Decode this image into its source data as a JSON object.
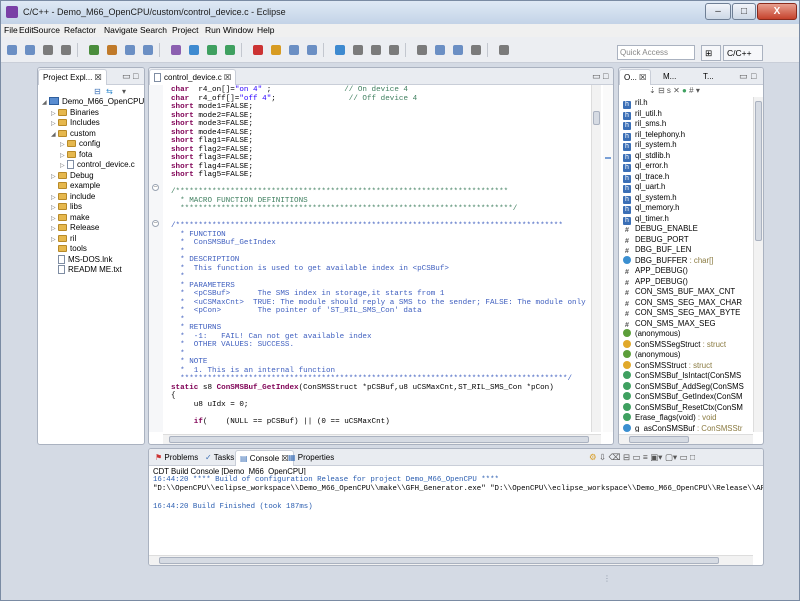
{
  "window": {
    "title": "C/C++ - Demo_M66_OpenCPU/custom/control_device.c - Eclipse",
    "min": "–",
    "max": "□",
    "close": "X"
  },
  "menu": [
    "File",
    "Edit",
    "Source",
    "Refactor",
    "Navigate",
    "Search",
    "Project",
    "Run",
    "Window",
    "Help"
  ],
  "toolbar": {
    "quick_access_placeholder": "Quick Access",
    "perspective": "C/C++"
  },
  "project_explorer": {
    "tab": "Project Expl... ☒",
    "tree": [
      {
        "label": "Demo_M66_OpenCPU",
        "depth": 0,
        "kind": "project",
        "open": true
      },
      {
        "label": "Binaries",
        "depth": 1,
        "kind": "bin",
        "open": false
      },
      {
        "label": "Includes",
        "depth": 1,
        "kind": "inc",
        "open": false
      },
      {
        "label": "custom",
        "depth": 1,
        "kind": "folder",
        "open": true
      },
      {
        "label": "config",
        "depth": 2,
        "kind": "folder",
        "open": false
      },
      {
        "label": "fota",
        "depth": 2,
        "kind": "folder",
        "open": false
      },
      {
        "label": "control_device.c",
        "depth": 2,
        "kind": "file",
        "open": false
      },
      {
        "label": "Debug",
        "depth": 1,
        "kind": "folder",
        "open": false
      },
      {
        "label": "example",
        "depth": 1,
        "kind": "folder",
        "open": null
      },
      {
        "label": "include",
        "depth": 1,
        "kind": "folder",
        "open": false
      },
      {
        "label": "libs",
        "depth": 1,
        "kind": "folder",
        "open": false
      },
      {
        "label": "make",
        "depth": 1,
        "kind": "folder",
        "open": false
      },
      {
        "label": "Release",
        "depth": 1,
        "kind": "folder",
        "open": false
      },
      {
        "label": "ril",
        "depth": 1,
        "kind": "folder",
        "open": false
      },
      {
        "label": "tools",
        "depth": 1,
        "kind": "folder",
        "open": null
      },
      {
        "label": "MS-DOS.lnk",
        "depth": 1,
        "kind": "file",
        "open": null
      },
      {
        "label": "READM ME.txt",
        "depth": 1,
        "kind": "file",
        "open": null
      }
    ]
  },
  "editor": {
    "tab": "control_device.c ☒",
    "lines": [
      [
        [
          "kw",
          "char"
        ],
        [
          "",
          "  r4_on[]="
        ],
        [
          "st",
          "\"on 4\""
        ],
        [
          "",
          " ;                "
        ],
        [
          "cm",
          "// On device 4"
        ]
      ],
      [
        [
          "kw",
          "char"
        ],
        [
          "",
          "  r4_off[]="
        ],
        [
          "st",
          "\"off 4\""
        ],
        [
          "",
          ";                "
        ],
        [
          "cm",
          "// Off device 4"
        ]
      ],
      [
        [
          "kw",
          "short"
        ],
        [
          "",
          " mode1=FALSE;"
        ]
      ],
      [
        [
          "kw",
          "short"
        ],
        [
          "",
          " mode2=FALSE;"
        ]
      ],
      [
        [
          "kw",
          "short"
        ],
        [
          "",
          " mode3=FALSE;"
        ]
      ],
      [
        [
          "kw",
          "short"
        ],
        [
          "",
          " mode4=FALSE;"
        ]
      ],
      [
        [
          "kw",
          "short"
        ],
        [
          "",
          " flag1=FALSE;"
        ]
      ],
      [
        [
          "kw",
          "short"
        ],
        [
          "",
          " flag2=FALSE;"
        ]
      ],
      [
        [
          "kw",
          "short"
        ],
        [
          "",
          " flag3=FALSE;"
        ]
      ],
      [
        [
          "kw",
          "short"
        ],
        [
          "",
          " flag4=FALSE;"
        ]
      ],
      [
        [
          "kw",
          "short"
        ],
        [
          "",
          " flag5=FALSE;"
        ]
      ],
      [
        [
          "",
          ""
        ]
      ],
      [
        [
          "cm",
          "/*************************************************************************"
        ]
      ],
      [
        [
          "cm",
          "  * MACRO FUNCTION DEFINITIONS"
        ]
      ],
      [
        [
          "cm",
          "  *************************************************************************/"
        ]
      ],
      [
        [
          "",
          ""
        ]
      ],
      [
        [
          "dc",
          "/*************************************************************************************"
        ]
      ],
      [
        [
          "dc",
          "  * FUNCTION"
        ]
      ],
      [
        [
          "dc",
          "  *  ConSMSBuf_GetIndex"
        ]
      ],
      [
        [
          "dc",
          "  *"
        ]
      ],
      [
        [
          "dc",
          "  * DESCRIPTION"
        ]
      ],
      [
        [
          "dc",
          "  *  This function is used to get available index in <pCSBuf>"
        ]
      ],
      [
        [
          "dc",
          "  *"
        ]
      ],
      [
        [
          "dc",
          "  * PARAMETERS"
        ]
      ],
      [
        [
          "dc",
          "  *  <pCSBuf>      The SMS index in storage,it starts from 1"
        ]
      ],
      [
        [
          "dc",
          "  *  <uCSMaxCnt>  TRUE: The module should reply a SMS to the sender; FALSE: The module only read this SMS."
        ]
      ],
      [
        [
          "dc",
          "  *  <pCon>        The pointer of 'ST_RIL_SMS_Con' data"
        ]
      ],
      [
        [
          "dc",
          "  *"
        ]
      ],
      [
        [
          "dc",
          "  * RETURNS"
        ]
      ],
      [
        [
          "dc",
          "  *  -1:   FAIL! Can not get available index"
        ]
      ],
      [
        [
          "dc",
          "  *  OTHER VALUES: SUCCESS."
        ]
      ],
      [
        [
          "dc",
          "  *"
        ]
      ],
      [
        [
          "dc",
          "  * NOTE"
        ]
      ],
      [
        [
          "dc",
          "  *  1. This is an internal function"
        ]
      ],
      [
        [
          "dc",
          "  *************************************************************************************/"
        ]
      ],
      [
        [
          "kw",
          "static"
        ],
        [
          "",
          " s8 "
        ],
        [
          "kw",
          "ConSMSBuf_GetIndex"
        ],
        [
          "",
          "(ConSMSStruct *pCSBuf,u8 uCSMaxCnt,ST_RIL_SMS_Con *pCon)"
        ]
      ],
      [
        [
          "",
          "{"
        ]
      ],
      [
        [
          "",
          "     u8 uIdx = 0;"
        ]
      ],
      [
        [
          "",
          ""
        ]
      ],
      [
        [
          "",
          "     "
        ],
        [
          "kw",
          "if"
        ],
        [
          "",
          "(    (NULL == pCSBuf) || (0 == uCSMaxCnt)"
        ]
      ]
    ]
  },
  "outline": {
    "tabs": [
      "O... ☒",
      "M...",
      "T..."
    ],
    "items": [
      {
        "icon": "h",
        "label": "ril.h",
        "type": ""
      },
      {
        "icon": "h",
        "label": "ril_util.h",
        "type": ""
      },
      {
        "icon": "h",
        "label": "ril_sms.h",
        "type": ""
      },
      {
        "icon": "h",
        "label": "ril_telephony.h",
        "type": ""
      },
      {
        "icon": "h",
        "label": "ril_system.h",
        "type": ""
      },
      {
        "icon": "h",
        "label": "ql_stdlib.h",
        "type": ""
      },
      {
        "icon": "h",
        "label": "ql_error.h",
        "type": ""
      },
      {
        "icon": "h",
        "label": "ql_trace.h",
        "type": ""
      },
      {
        "icon": "h",
        "label": "ql_uart.h",
        "type": ""
      },
      {
        "icon": "h",
        "label": "ql_system.h",
        "type": ""
      },
      {
        "icon": "h",
        "label": "ql_memory.h",
        "type": ""
      },
      {
        "icon": "h",
        "label": "ql_timer.h",
        "type": ""
      },
      {
        "icon": "m",
        "label": "DEBUG_ENABLE",
        "type": ""
      },
      {
        "icon": "m",
        "label": "DEBUG_PORT",
        "type": ""
      },
      {
        "icon": "m",
        "label": "DBG_BUF_LEN",
        "type": ""
      },
      {
        "icon": "an",
        "label": "DBG_BUFFER",
        "type": " : char[]"
      },
      {
        "icon": "m",
        "label": "APP_DEBUG()",
        "type": ""
      },
      {
        "icon": "m",
        "label": "APP_DEBUG()",
        "type": ""
      },
      {
        "icon": "m",
        "label": "CON_SMS_BUF_MAX_CNT",
        "type": ""
      },
      {
        "icon": "m",
        "label": "CON_SMS_SEG_MAX_CHAR",
        "type": ""
      },
      {
        "icon": "m",
        "label": "CON_SMS_SEG_MAX_BYTE",
        "type": ""
      },
      {
        "icon": "m",
        "label": "CON_SMS_MAX_SEG",
        "type": ""
      },
      {
        "icon": "s",
        "label": "(anonymous)",
        "type": ""
      },
      {
        "icon": "st",
        "label": "ConSMSSegStruct",
        "type": " : struct"
      },
      {
        "icon": "s",
        "label": "(anonymous)",
        "type": ""
      },
      {
        "icon": "st",
        "label": "ConSMSStruct",
        "type": " : struct"
      },
      {
        "icon": "f",
        "label": "ConSMSBuf_IsIntact(ConSMS",
        "type": ""
      },
      {
        "icon": "f",
        "label": "ConSMSBuf_AddSeg(ConSMS",
        "type": ""
      },
      {
        "icon": "f",
        "label": "ConSMSBuf_GetIndex(ConSM",
        "type": ""
      },
      {
        "icon": "f",
        "label": "ConSMSBuf_ResetCtx(ConSM",
        "type": ""
      },
      {
        "icon": "f",
        "label": "Erase_flags(void)",
        "type": " : void"
      },
      {
        "icon": "an",
        "label": "g_asConSMSBuf",
        "type": " : ConSMSStr"
      }
    ]
  },
  "bottom": {
    "tabs": [
      "Problems",
      "Tasks",
      "Console ☒",
      "Properties"
    ],
    "console_title": "CDT Build Console [Demo_M66_OpenCPU]",
    "lines": [
      "16:44:20 **** Build of configuration Release for project Demo_M66_OpenCPU ****",
      "\"D:\\\\OpenCPU\\\\eclipse_workspace\\\\Demo_M66_OpenCPU\\\\make\\\\GFH_Generator.exe\" \"D:\\\\OpenCPU\\\\eclipse_workspace\\\\Demo_M66_OpenCPU\\\\Release\\\\APPGS3MDM32A",
      "",
      "16:44:20 Build Finished (took 187ms)"
    ]
  },
  "colors": {
    "frame": "#d4dae4",
    "accent": "#3b6fb6",
    "keyword": "#7f0055",
    "comment": "#3f7f5f",
    "doc": "#3f5fbf",
    "string": "#2a00ff"
  }
}
